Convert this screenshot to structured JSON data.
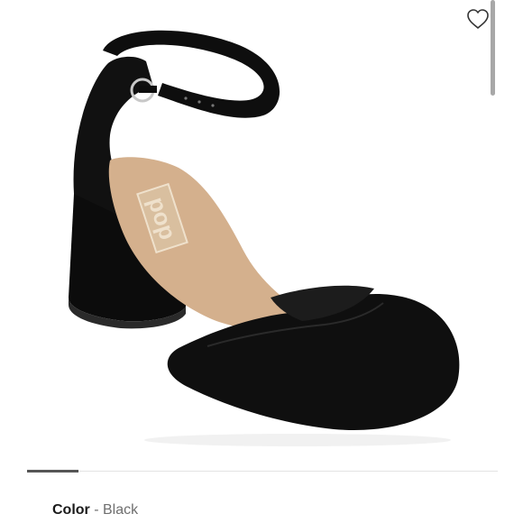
{
  "product": {
    "image_alt": "Black suede block heel ankle strap pump",
    "insole_logo_text": "pop",
    "wishlist_icon": "heart-outline-icon"
  },
  "gallery": {
    "indicator_position": 1
  },
  "details": {
    "color_label": "Color",
    "color_separator": " - ",
    "color_value": "Black"
  },
  "colors": {
    "suede": "#0e0e0e",
    "insole": "#d4b08d",
    "indicator": "#555555",
    "scrollbar": "#a8a8a8"
  }
}
